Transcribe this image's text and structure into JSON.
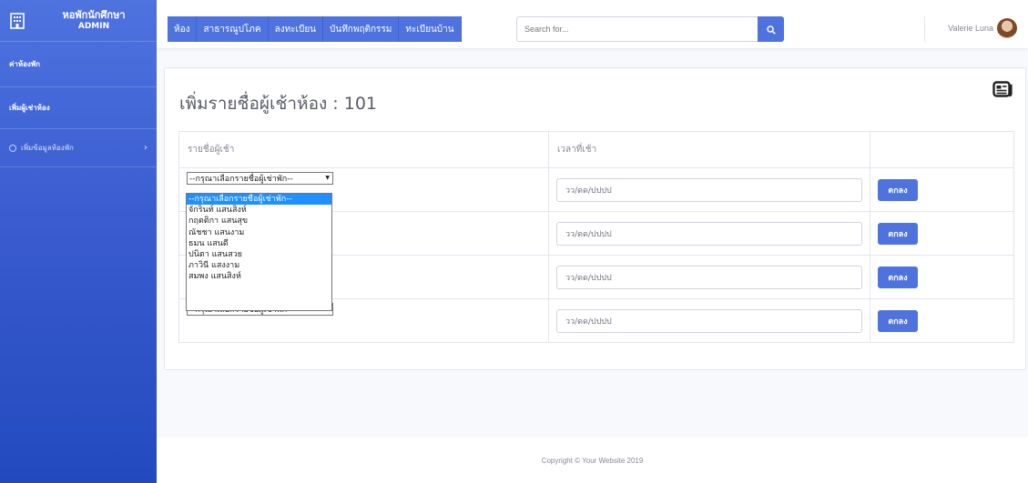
{
  "brand": {
    "title": "หอพักนักศึกษา",
    "subtitle": "ADMIN",
    "icon": "building-icon"
  },
  "sidebar": {
    "items": [
      {
        "label": "ค่าห้องพัก"
      },
      {
        "label": "เพิ่มผู้เช่าห้อง"
      },
      {
        "label": "เพิ่มข้อมูลห้องพัก"
      }
    ]
  },
  "topbar": {
    "menu": [
      "ห้อง",
      "สาธารณูปโภค",
      "ลงทะเบียน",
      "บันทึกพฤติกรรม",
      "ทะเบียนบ้าน"
    ],
    "search_placeholder": "Search for...",
    "user_name": "Valerie Luna"
  },
  "main": {
    "title": "เพิ่มรายชื่อผู้เช้าห้อง : 101",
    "headers": [
      "รายชื่อผู้เช้า",
      "เวลาที่เช้า",
      ""
    ],
    "rows": [
      {
        "select": "--กรุณาเลือกรายชื่อผู้เช่าพัก--",
        "date_placeholder": "วว/ดด/ปปปป",
        "button": "ตกลง"
      },
      {
        "select": "",
        "date_placeholder": "วว/ดด/ปปปป",
        "button": "ตกลง"
      },
      {
        "select": "",
        "date_placeholder": "วว/ดด/ปปปป",
        "button": "ตกลง"
      },
      {
        "select": "--กรุณาเลือกรายชื่อผู้เช่าพัก--",
        "date_placeholder": "วว/ดด/ปปปป",
        "button": "ตกลง"
      }
    ],
    "dropdown_options": [
      "--กรุณาเลือกรายชื่อผู้เช่าพัก--",
      "จักรินท์ แสนสิงห์",
      "กฤตติกา แสนสุข",
      "ณัชชา แสนงาม",
      "ธมน แสนดี",
      "ปนิตา แสนสวย",
      "ภาวินี แสงงาม",
      "สมพง แสนสิงห์"
    ]
  },
  "footer": {
    "text": "Copyright © Your Website 2019"
  },
  "colors": {
    "primary": "#4e73df",
    "sidebar_dark": "#224abe",
    "selected_option": "#1e90ff"
  }
}
